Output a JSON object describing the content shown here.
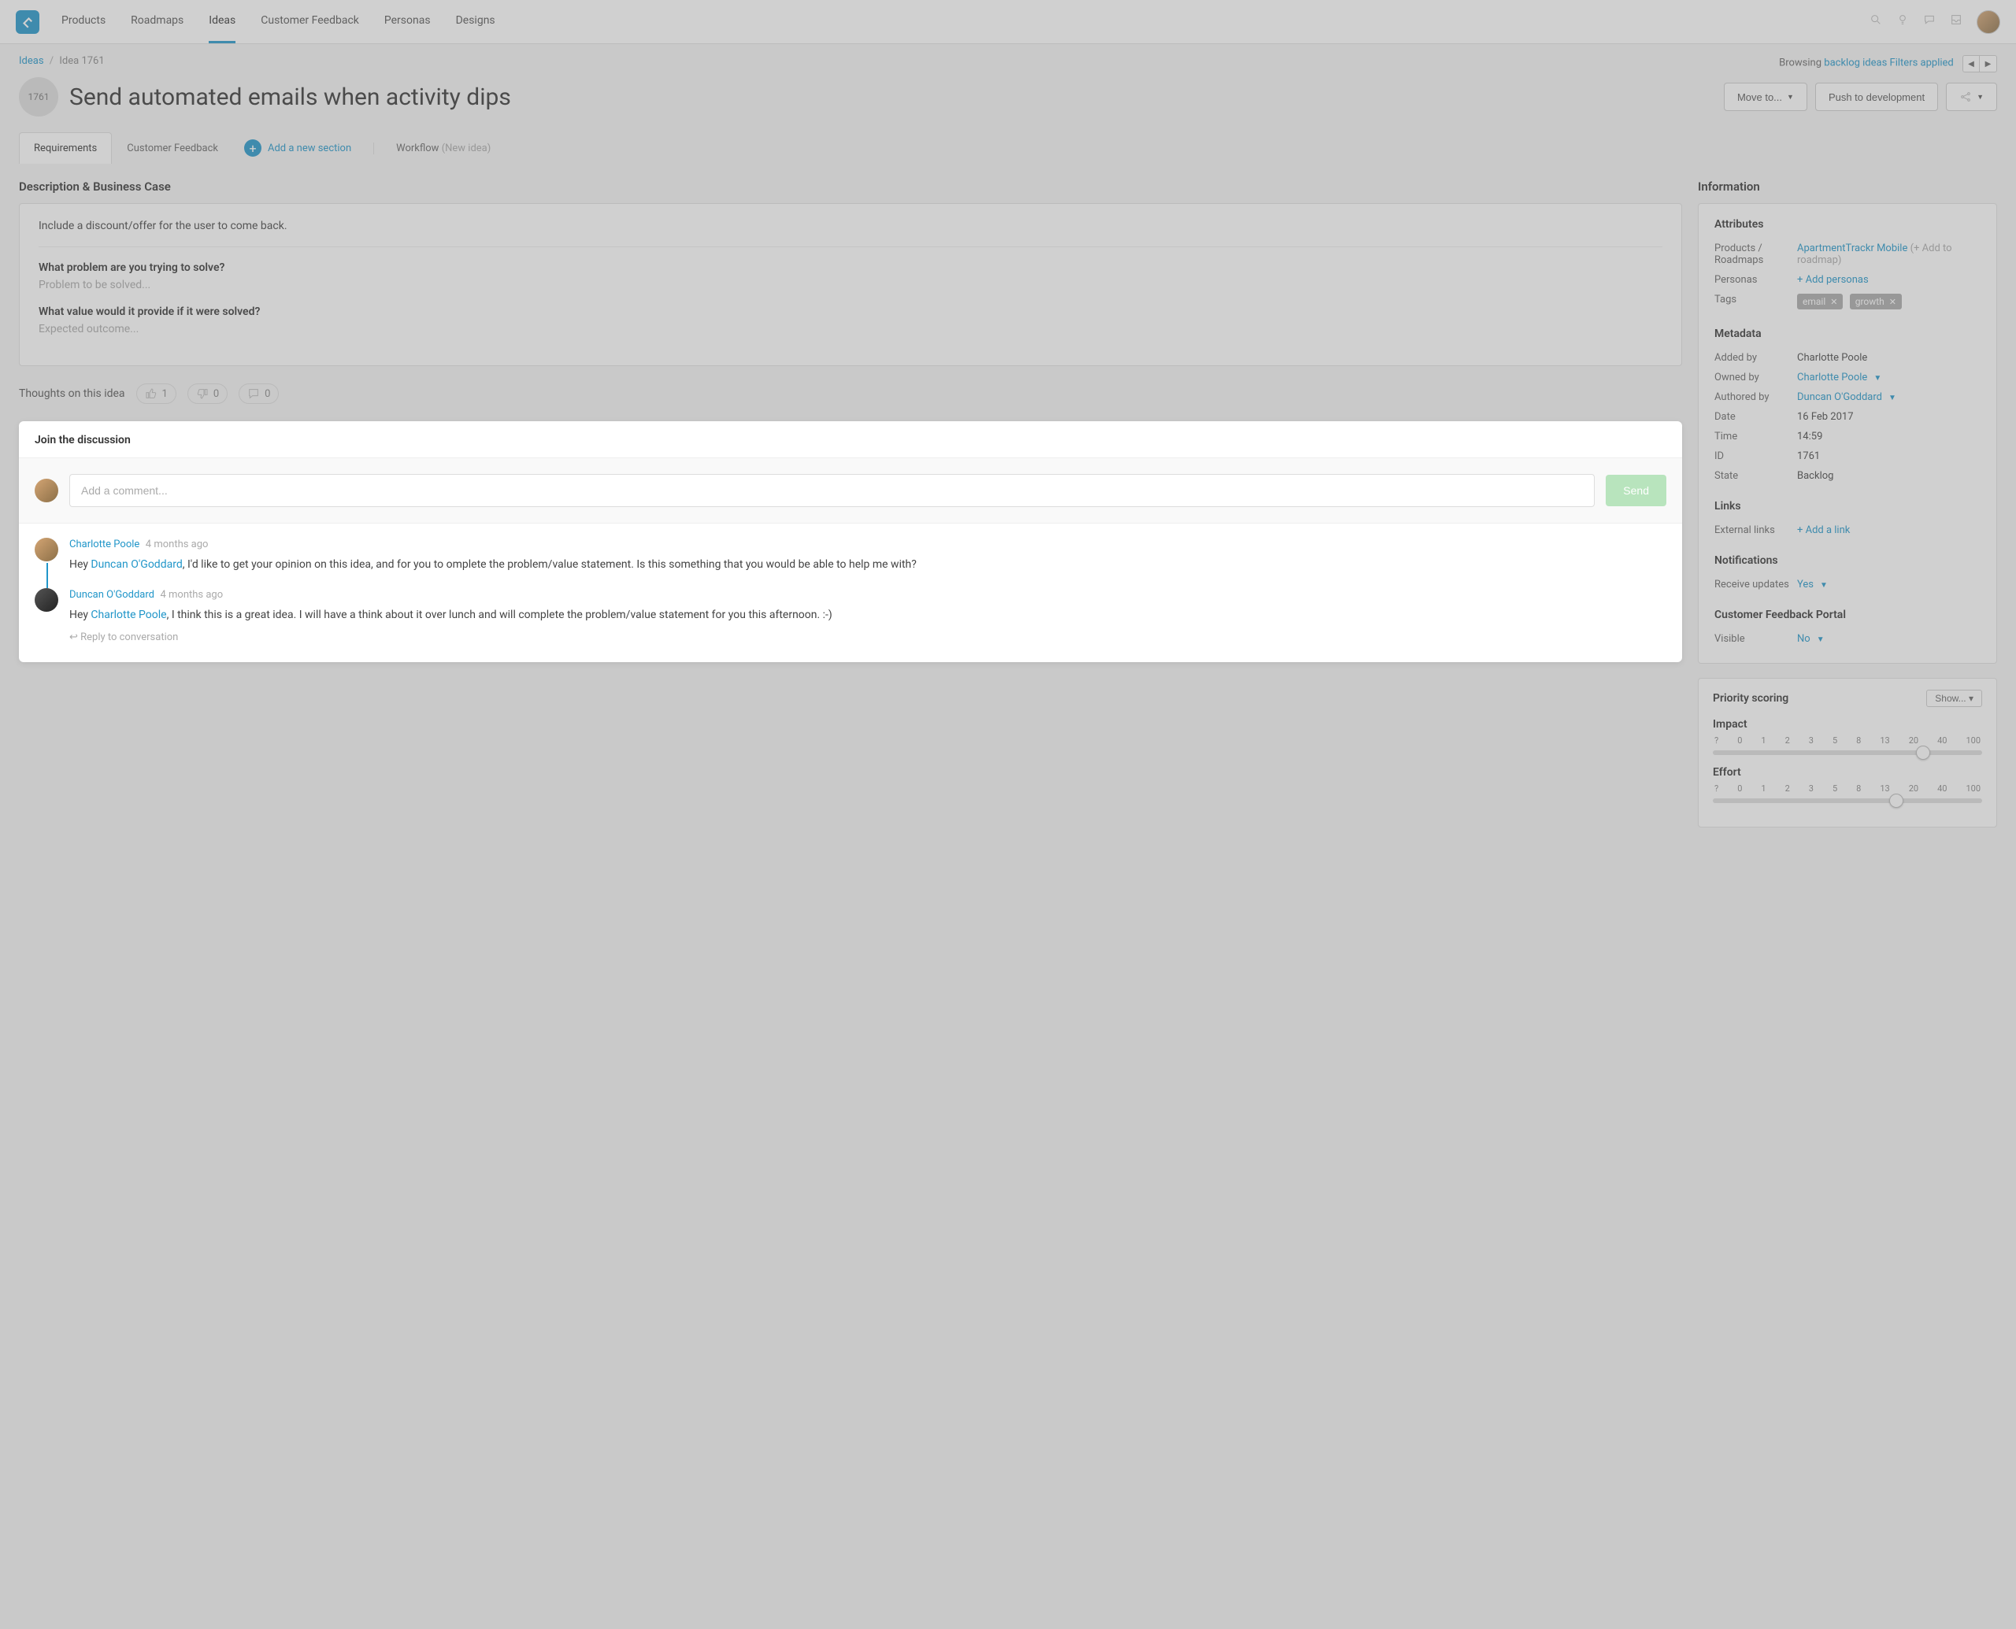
{
  "nav": {
    "items": [
      "Products",
      "Roadmaps",
      "Ideas",
      "Customer Feedback",
      "Personas",
      "Designs"
    ],
    "active_index": 2
  },
  "breadcrumb": {
    "root": "Ideas",
    "current": "Idea 1761",
    "browsing_prefix": "Browsing",
    "browsing_link": "backlog ideas",
    "filters_link": "Filters applied"
  },
  "idea": {
    "badge": "1761",
    "title": "Send automated emails when activity dips",
    "move_to": "Move to...",
    "push_dev": "Push to development"
  },
  "tabs": {
    "items": [
      "Requirements",
      "Customer Feedback"
    ],
    "active_index": 0,
    "add_section": "Add a new section",
    "workflow_label": "Workflow",
    "workflow_status": "(New idea)"
  },
  "description": {
    "heading": "Description & Business Case",
    "body": "Include a discount/offer for the user to come back.",
    "q1": "What problem are you trying to solve?",
    "q1_placeholder": "Problem to be solved...",
    "q2": "What value would it provide if it were solved?",
    "q2_placeholder": "Expected outcome..."
  },
  "thoughts": {
    "label": "Thoughts on this idea",
    "up": "1",
    "down": "0",
    "comments": "0"
  },
  "discussion": {
    "heading": "Join the discussion",
    "input_placeholder": "Add a comment...",
    "send": "Send",
    "reply": "Reply to conversation",
    "comments": [
      {
        "author": "Charlotte Poole",
        "time": "4 months ago",
        "prefix": "Hey ",
        "mention": "Duncan O'Goddard",
        "suffix": ", I'd like to get your opinion on this idea, and for you to omplete the problem/value statement.  Is this something that you would be able to help me with?"
      },
      {
        "author": "Duncan O'Goddard",
        "time": "4 months ago",
        "prefix": "Hey ",
        "mention": "Charlotte Poole",
        "suffix": ", I think this is a great idea.  I will have a think about it over lunch and will complete the problem/value statement for you this afternoon. :-)"
      }
    ]
  },
  "info": {
    "heading": "Information",
    "attributes_h": "Attributes",
    "products_label": "Products / Roadmaps",
    "products_value": "ApartmentTrackr Mobile",
    "products_add": "(+ Add to roadmap)",
    "personas_label": "Personas",
    "personas_add": "+ Add personas",
    "tags_label": "Tags",
    "tags": [
      "email",
      "growth"
    ],
    "metadata_h": "Metadata",
    "metadata": {
      "added_by_label": "Added by",
      "added_by": "Charlotte Poole",
      "owned_by_label": "Owned by",
      "owned_by": "Charlotte Poole",
      "authored_by_label": "Authored by",
      "authored_by": "Duncan O'Goddard",
      "date_label": "Date",
      "date": "16 Feb 2017",
      "time_label": "Time",
      "time": "14:59",
      "id_label": "ID",
      "id": "1761",
      "state_label": "State",
      "state": "Backlog"
    },
    "links_h": "Links",
    "external_links_label": "External links",
    "add_link": "+ Add a link",
    "notifications_h": "Notifications",
    "receive_label": "Receive updates",
    "receive_value": "Yes",
    "portal_h": "Customer Feedback Portal",
    "visible_label": "Visible",
    "visible_value": "No"
  },
  "priority": {
    "heading": "Priority scoring",
    "show": "Show...",
    "sliders": [
      {
        "label": "Impact",
        "ticks": [
          "?",
          "0",
          "1",
          "2",
          "3",
          "5",
          "8",
          "13",
          "20",
          "40",
          "100"
        ],
        "pos_pct": 78
      },
      {
        "label": "Effort",
        "ticks": [
          "?",
          "0",
          "1",
          "2",
          "3",
          "5",
          "8",
          "13",
          "20",
          "40",
          "100"
        ],
        "pos_pct": 68
      }
    ]
  }
}
